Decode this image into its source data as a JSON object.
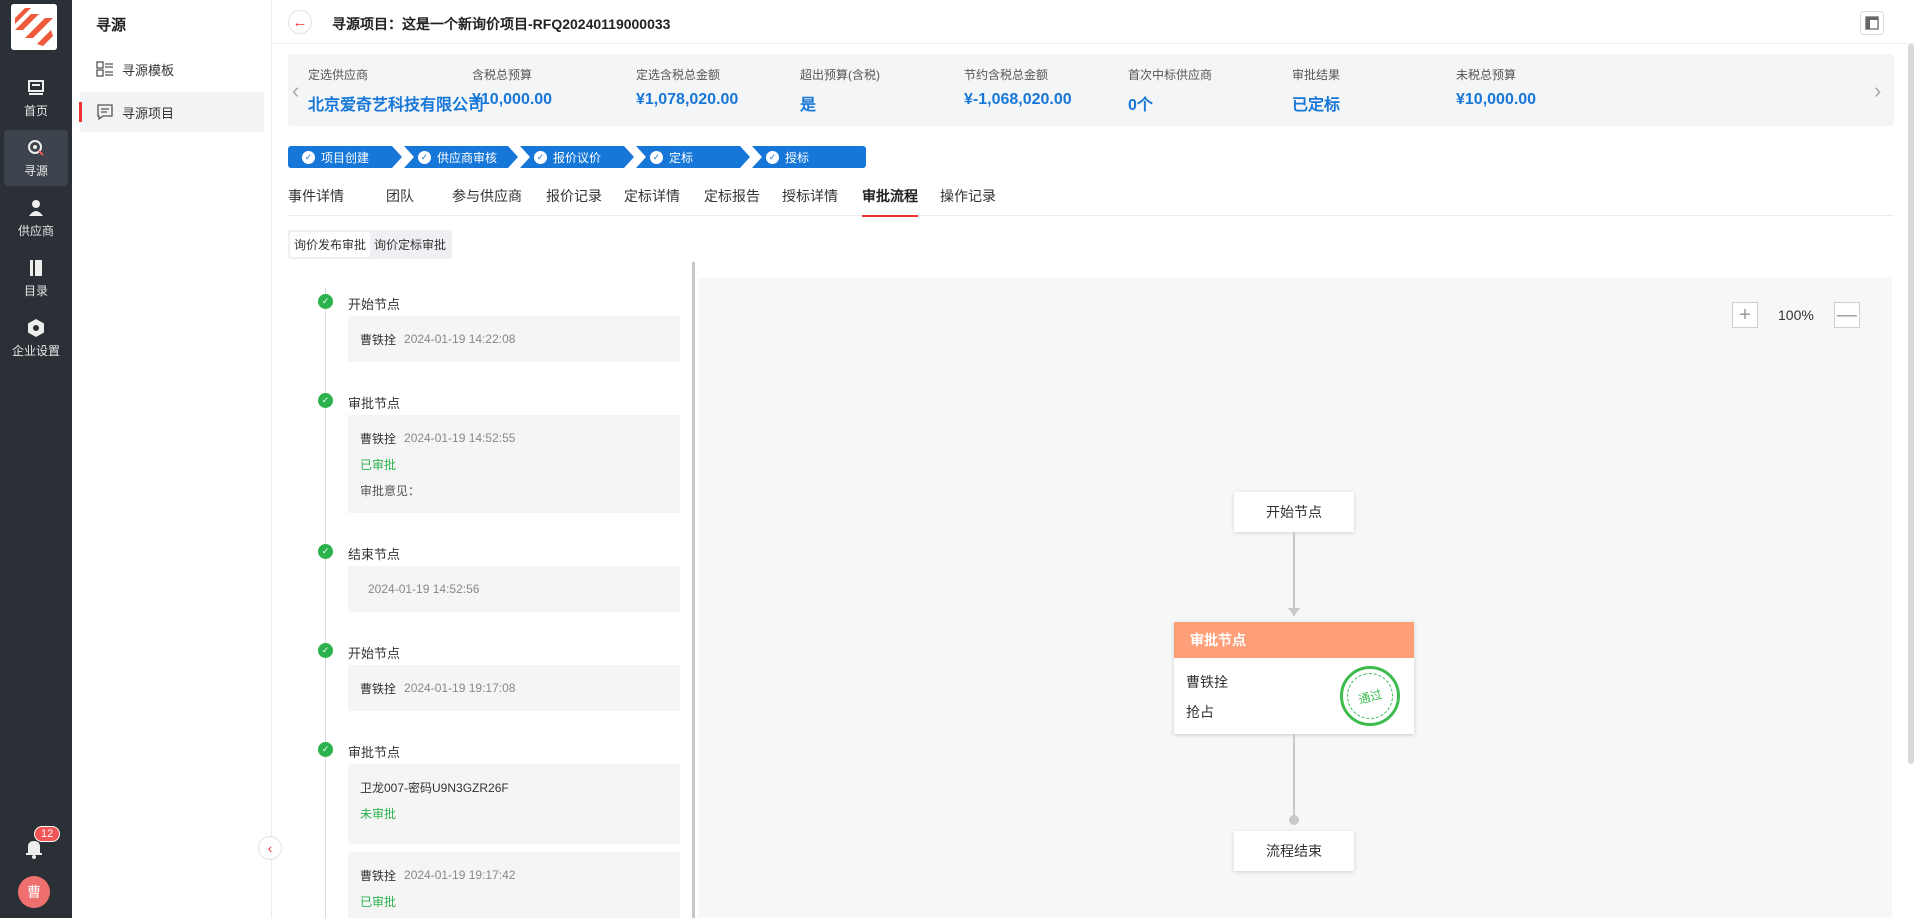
{
  "rail": {
    "items": [
      {
        "label": "首页"
      },
      {
        "label": "寻源"
      },
      {
        "label": "供应商"
      },
      {
        "label": "目录"
      },
      {
        "label": "企业设置"
      }
    ],
    "notification_count": "12",
    "avatar_text": "曹"
  },
  "sidebar": {
    "title": "寻源",
    "items": [
      {
        "label": "寻源模板"
      },
      {
        "label": "寻源项目"
      }
    ]
  },
  "header": {
    "title": "寻源项目：这是一个新询价项目-RFQ20240119000033"
  },
  "summary": [
    {
      "label": "定选供应商",
      "value": "北京爱奇艺科技有限公司"
    },
    {
      "label": "含税总预算",
      "value": "¥10,000.00"
    },
    {
      "label": "定选含税总金额",
      "value": "¥1,078,020.00"
    },
    {
      "label": "超出预算(含税)",
      "value": "是"
    },
    {
      "label": "节约含税总金额",
      "value": "¥-1,068,020.00"
    },
    {
      "label": "首次中标供应商",
      "value": "0个"
    },
    {
      "label": "审批结果",
      "value": "已定标"
    },
    {
      "label": "未税总预算",
      "value": "¥10,000.00"
    }
  ],
  "steps": [
    "项目创建",
    "供应商审核",
    "报价议价",
    "定标",
    "授标"
  ],
  "tabs": [
    "事件详情",
    "团队",
    "参与供应商",
    "报价记录",
    "定标详情",
    "定标报告",
    "授标详情",
    "审批流程",
    "操作记录"
  ],
  "subtabs": [
    "询价发布审批",
    "询价定标审批"
  ],
  "timeline": [
    {
      "name": "开始节点",
      "who": "曹铁拴",
      "time": "2024-01-19 14:22:08"
    },
    {
      "name": "审批节点",
      "who": "曹铁拴",
      "time": "2024-01-19 14:52:55",
      "status": "已审批",
      "note": "审批意见："
    },
    {
      "name": "结束节点",
      "who": "",
      "time": "2024-01-19 14:52:56"
    },
    {
      "name": "开始节点",
      "who": "曹铁拴",
      "time": "2024-01-19 19:17:08"
    },
    {
      "name": "审批节点",
      "who": "卫龙007-密码U9N3GZR26F",
      "status": "未审批",
      "who2": "曹铁拴",
      "time2": "2024-01-19 19:17:42",
      "status2": "已审批"
    }
  ],
  "flow": {
    "zoom": "100%",
    "start_node": "开始节点",
    "approval": {
      "title": "审批节点",
      "approver": "曹铁拴",
      "mode": "抢占",
      "stamp": "通过"
    },
    "end_node": "流程结束"
  },
  "colors": {
    "accent": "#1677d9",
    "danger": "#ee3333",
    "success": "#2bb24c",
    "approval_header": "#ff9f7a",
    "rail": "#2b2f36"
  }
}
